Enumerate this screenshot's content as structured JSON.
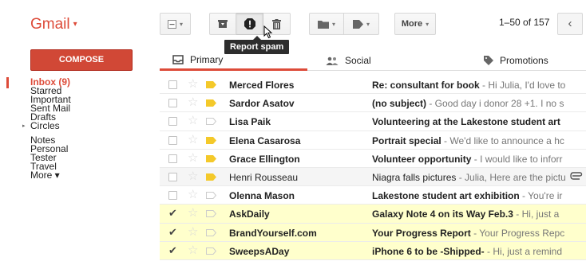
{
  "logo": {
    "text": "Gmail",
    "caret": "▾"
  },
  "toolbar": {
    "select_dropdown": "▾",
    "more_label": "More",
    "more_caret": "▾",
    "tooltip": "Report spam"
  },
  "pager": {
    "text": "1–50 of 157",
    "prev": "‹"
  },
  "compose_label": "COMPOSE",
  "sidebar": {
    "inbox": "Inbox (9)",
    "starred": "Starred",
    "important": "Important",
    "sent": "Sent Mail",
    "drafts": "Drafts",
    "circles": "Circles",
    "circles_arrow": "▸",
    "notes": "Notes",
    "personal": "Personal",
    "tester": "Tester",
    "travel": "Travel",
    "more": "More ▾"
  },
  "tabs": {
    "primary": "Primary",
    "social": "Social",
    "promotions": "Promotions"
  },
  "emails": [
    {
      "sender": "Merced Flores",
      "subject": "Re: consultant for book",
      "snippet": " - Hi Julia, I'd love to"
    },
    {
      "sender": "Sardor Asatov",
      "subject": "(no subject)",
      "snippet": " - Good day i donor 28 +1. I no s"
    },
    {
      "sender": "Lisa Paik",
      "subject": "Volunteering at the Lakestone student art",
      "snippet": ""
    },
    {
      "sender": "Elena Casarosa",
      "subject": "Portrait special",
      "snippet": " - We'd like to announce a hc"
    },
    {
      "sender": "Grace Ellington",
      "subject": "Volunteer opportunity",
      "snippet": " - I would like to inforr"
    },
    {
      "sender": "Henri Rousseau",
      "subject": "Niagra falls pictures",
      "snippet": " - Julia, Here are the pictu"
    },
    {
      "sender": "Olenna Mason",
      "subject": "Lakestone student art exhibition",
      "snippet": " - You're ir"
    },
    {
      "sender": "AskDaily",
      "subject": "Galaxy Note 4 on its Way Feb.3",
      "snippet": " - Hi, just a"
    },
    {
      "sender": "BrandYourself.com",
      "subject": "Your Progress Report",
      "snippet": " - Your Progress Repc"
    },
    {
      "sender": "SweepsADay",
      "subject": "iPhone 6 to be -Shipped-",
      "snippet": " - Hi, just a remind"
    }
  ],
  "colors": {
    "accent": "#dd4b39",
    "compose_bg": "#d14836",
    "important_marker": "#f4c92a",
    "selected_row": "#ffffcc"
  }
}
